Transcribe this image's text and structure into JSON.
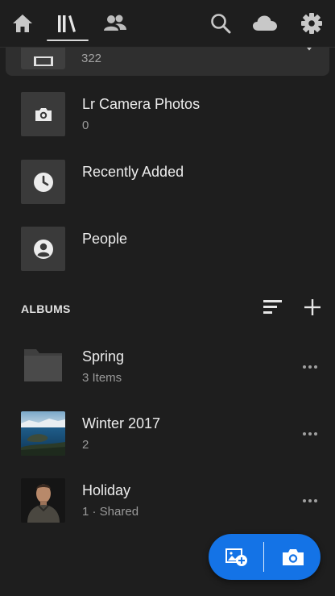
{
  "topbar": {
    "tabs": [
      {
        "icon": "home-icon"
      },
      {
        "icon": "library-icon",
        "active": true
      },
      {
        "icon": "people-icon"
      }
    ],
    "actions": [
      {
        "icon": "search-icon"
      },
      {
        "icon": "cloud-icon"
      },
      {
        "icon": "settings-icon"
      }
    ]
  },
  "library": {
    "all_photos_count": "322",
    "items": [
      {
        "title": "Lr Camera Photos",
        "count": "0",
        "icon": "camera-icon"
      },
      {
        "title": "Recently Added",
        "count": "",
        "icon": "clock-icon"
      },
      {
        "title": "People",
        "count": "",
        "icon": "person-icon"
      }
    ]
  },
  "albums": {
    "heading": "ALBUMS",
    "list": [
      {
        "title": "Spring",
        "subtitle": "3 Items",
        "thumb": "folder-icon"
      },
      {
        "title": "Winter 2017",
        "subtitle": "2",
        "thumb": "lake-photo"
      },
      {
        "title": "Holiday",
        "subtitle": "1 · Shared",
        "thumb": "portrait-photo"
      }
    ]
  },
  "fab": {
    "left_icon": "add-photo-icon",
    "right_icon": "camera-icon"
  },
  "colors": {
    "background": "#1e1e1e",
    "tile": "#3a3a3a",
    "accent": "#1473e6"
  }
}
